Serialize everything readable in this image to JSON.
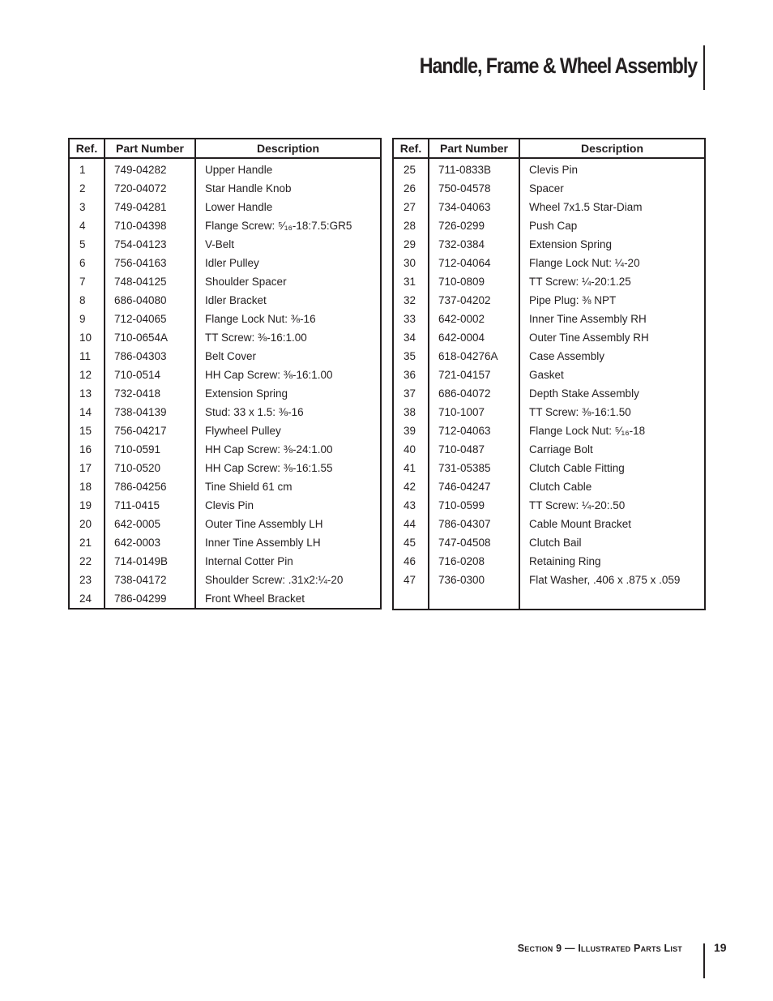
{
  "header": {
    "title": "Handle, Frame & Wheel Assembly"
  },
  "table_headers": {
    "ref": "Ref.",
    "part_number": "Part Number",
    "description": "Description"
  },
  "left_table": [
    {
      "ref": "1",
      "part": "749-04282",
      "desc": "Upper Handle"
    },
    {
      "ref": "2",
      "part": "720-04072",
      "desc": "Star Handle Knob"
    },
    {
      "ref": "3",
      "part": "749-04281",
      "desc": "Lower Handle"
    },
    {
      "ref": "4",
      "part": "710-04398",
      "desc": "Flange Screw: ⁵⁄₁₆-18:7.5:GR5"
    },
    {
      "ref": "5",
      "part": "754-04123",
      "desc": "V-Belt"
    },
    {
      "ref": "6",
      "part": "756-04163",
      "desc": "Idler Pulley"
    },
    {
      "ref": "7",
      "part": "748-04125",
      "desc": "Shoulder Spacer"
    },
    {
      "ref": "8",
      "part": "686-04080",
      "desc": "Idler Bracket"
    },
    {
      "ref": "9",
      "part": "712-04065",
      "desc": "Flange Lock Nut: ⅜-16"
    },
    {
      "ref": "10",
      "part": "710-0654A",
      "desc": "TT Screw: ⅜-16:1.00"
    },
    {
      "ref": "11",
      "part": "786-04303",
      "desc": "Belt Cover"
    },
    {
      "ref": "12",
      "part": "710-0514",
      "desc": "HH Cap Screw: ⅜-16:1.00"
    },
    {
      "ref": "13",
      "part": "732-0418",
      "desc": "Extension Spring"
    },
    {
      "ref": "14",
      "part": "738-04139",
      "desc": "Stud: 33 x 1.5: ⅜-16"
    },
    {
      "ref": "15",
      "part": "756-04217",
      "desc": "Flywheel Pulley"
    },
    {
      "ref": "16",
      "part": "710-0591",
      "desc": "HH Cap Screw: ⅜-24:1.00"
    },
    {
      "ref": "17",
      "part": "710-0520",
      "desc": "HH Cap Screw: ⅜-16:1.55"
    },
    {
      "ref": "18",
      "part": "786-04256",
      "desc": "Tine Shield 61 cm"
    },
    {
      "ref": "19",
      "part": "711-0415",
      "desc": "Clevis Pin"
    },
    {
      "ref": "20",
      "part": "642-0005",
      "desc": "Outer Tine Assembly LH"
    },
    {
      "ref": "21",
      "part": "642-0003",
      "desc": "Inner Tine Assembly LH"
    },
    {
      "ref": "22",
      "part": "714-0149B",
      "desc": "Internal Cotter Pin"
    },
    {
      "ref": "23",
      "part": "738-04172",
      "desc": "Shoulder Screw: .31x2:¼-20"
    },
    {
      "ref": "24",
      "part": "786-04299",
      "desc": "Front Wheel Bracket"
    }
  ],
  "right_table": [
    {
      "ref": "25",
      "part": "711-0833B",
      "desc": "Clevis Pin"
    },
    {
      "ref": "26",
      "part": "750-04578",
      "desc": "Spacer"
    },
    {
      "ref": "27",
      "part": "734-04063",
      "desc": "Wheel 7x1.5 Star-Diam"
    },
    {
      "ref": "28",
      "part": "726-0299",
      "desc": "Push Cap"
    },
    {
      "ref": "29",
      "part": "732-0384",
      "desc": "Extension Spring"
    },
    {
      "ref": "30",
      "part": "712-04064",
      "desc": "Flange Lock Nut: ¼-20"
    },
    {
      "ref": "31",
      "part": "710-0809",
      "desc": "TT Screw: ¼-20:1.25"
    },
    {
      "ref": "32",
      "part": "737-04202",
      "desc": "Pipe Plug: ⅜ NPT"
    },
    {
      "ref": "33",
      "part": "642-0002",
      "desc": "Inner Tine Assembly RH"
    },
    {
      "ref": "34",
      "part": "642-0004",
      "desc": "Outer Tine Assembly RH"
    },
    {
      "ref": "35",
      "part": "618-04276A",
      "desc": "Case Assembly"
    },
    {
      "ref": "36",
      "part": "721-04157",
      "desc": "Gasket"
    },
    {
      "ref": "37",
      "part": "686-04072",
      "desc": "Depth Stake Assembly"
    },
    {
      "ref": "38",
      "part": "710-1007",
      "desc": "TT Screw: ⅜-16:1.50"
    },
    {
      "ref": "39",
      "part": "712-04063",
      "desc": "Flange Lock Nut: ⁵⁄₁₆-18"
    },
    {
      "ref": "40",
      "part": "710-0487",
      "desc": "Carriage Bolt"
    },
    {
      "ref": "41",
      "part": "731-05385",
      "desc": "Clutch Cable Fitting"
    },
    {
      "ref": "42",
      "part": "746-04247",
      "desc": "Clutch Cable"
    },
    {
      "ref": "43",
      "part": "710-0599",
      "desc": "TT Screw: ¼-20:.50"
    },
    {
      "ref": "44",
      "part": "786-04307",
      "desc": "Cable Mount Bracket"
    },
    {
      "ref": "45",
      "part": "747-04508",
      "desc": "Clutch Bail"
    },
    {
      "ref": "46",
      "part": "716-0208",
      "desc": "Retaining Ring"
    },
    {
      "ref": "47",
      "part": "736-0300",
      "desc": "Flat Washer, .406 x .875 x .059"
    }
  ],
  "footer": {
    "section": "Section 9 — Illustrated Parts List",
    "page_number": "19"
  }
}
